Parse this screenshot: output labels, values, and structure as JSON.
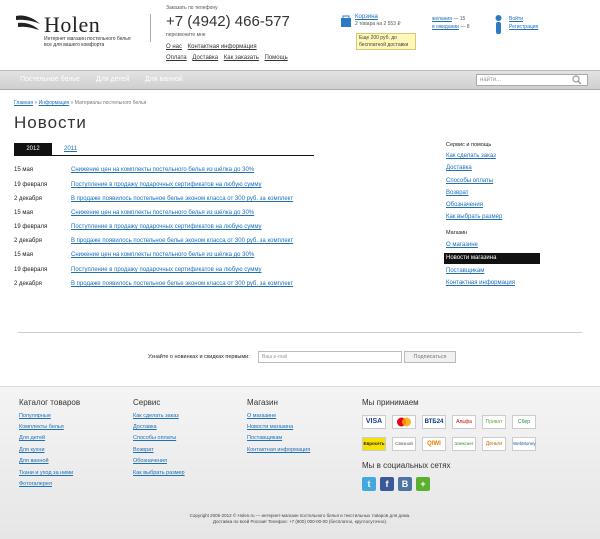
{
  "brand": {
    "name": "Holen",
    "tagline": "Интернет магазин постельного белья все для вашего комфорта"
  },
  "contact": {
    "order_label": "Заказать по телефону",
    "phone": "+7 (4942) 466-577",
    "callback": "перезвоните мне"
  },
  "toplinks": {
    "row1": [
      "О нас",
      "Контактная информация"
    ],
    "row2": [
      "Оплата",
      "Доставка",
      "Как заказать",
      "Помощь"
    ]
  },
  "cart": {
    "title": "Корзина",
    "summary": "2 товара  на 2 553 ₽",
    "promo": "Еще 200 руб. до бесплатной доставки"
  },
  "wishlist": {
    "wish_label": "желания",
    "wish_count": "— 15",
    "wait_label": "в ожидании",
    "wait_count": "— 8"
  },
  "auth": {
    "login": "Войти",
    "register": "Регистрация"
  },
  "nav": {
    "items": [
      "Постельное белье",
      "Для детей",
      "Для ванной"
    ],
    "search_placeholder": "найти..."
  },
  "breadcrumb": {
    "home": "Главная",
    "info": "Информация",
    "current": "Материалы постельного белья"
  },
  "page_title": "Новости",
  "years": {
    "active": "2012",
    "other": "2011"
  },
  "news": [
    {
      "date": "15 мая",
      "title": "Снижение цен на комплекты постельного белья из шёлка до 30%"
    },
    {
      "date": "19 февраля",
      "title": "Поступление в продажу подарочных сертификатов на любую сумму"
    },
    {
      "date": "2 декабря",
      "title": "В продаже появилось постельное белье эконом класса от 300 руб. за комплект"
    },
    {
      "date": "15 мая",
      "title": "Снижение цен на комплекты постельного белья из шёлка до 30%"
    },
    {
      "date": "19 февраля",
      "title": "Поступление в продажу подарочных сертификатов на любую сумму"
    },
    {
      "date": "2 декабря",
      "title": "В продаже появилось постельное белье эконом класса от 300 руб. за комплект"
    },
    {
      "date": "15 мая",
      "title": "Снижение цен на комплекты постельного белья из шёлка до 30%"
    },
    {
      "date": "19 февраля",
      "title": "Поступление в продажу подарочных сертификатов на любую сумму"
    },
    {
      "date": "2 декабря",
      "title": "В продаже появилось постельное белье эконом класса от 300 руб. за комплект"
    }
  ],
  "sidebar": {
    "service_title": "Сервис и помощь",
    "service": [
      "Как сделать заказ",
      "Доставка",
      "Способы оплаты",
      "Возврат",
      "Обозначения",
      "Как выбрать размер"
    ],
    "shop_title": "Магазин",
    "shop_before": [
      "О магазине"
    ],
    "shop_active": "Новости магазина",
    "shop_after": [
      "Поставщикам",
      "Контактная информация"
    ]
  },
  "subscribe": {
    "label": "Узнайте о новинках и скидках первыми:",
    "placeholder": "Ваш e-mail",
    "button": "Подписаться"
  },
  "footer": {
    "catalog_title": "Каталог товаров",
    "catalog": [
      "Популярные",
      "Комплекты белья",
      "Для детей",
      "Для кухни",
      "Для ванной",
      "Ткани и уход за ними",
      "Фотогалерея"
    ],
    "service_title": "Сервис",
    "service": [
      "Как сделать заказ",
      "Доставка",
      "Способы оплаты",
      "Возврат",
      "Обозначения",
      "Как выбрать размер"
    ],
    "shop_title": "Магазин",
    "shop": [
      "О магазине",
      "Новости магазина",
      "Поставщикам",
      "Контактная информация"
    ],
    "pay_title": "Мы принимаем",
    "pay_logos": [
      "VISA",
      "MC",
      "ВТБ24",
      "Альфа",
      "Приват",
      "Сбер",
      "Евросеть",
      "Связной",
      "QIWI",
      "Элекснет",
      "Деньги",
      "WebMoney"
    ],
    "social_title": "Мы в социальных сетях",
    "social": [
      "t",
      "f",
      "В",
      "+"
    ],
    "copyright": "Copyright 2005-2012 © Holen.ru — интернет-магазин постельного белья и текстильных товаров для дома.",
    "phone_line": "Доставка по всей России! Телефон: +7 (800) 000-00-00 (бесплатно, круглосуточно)."
  },
  "colors": {
    "link": "#1d6fb8",
    "active_bg": "#111111",
    "promo_bg": "#fff7b8"
  }
}
